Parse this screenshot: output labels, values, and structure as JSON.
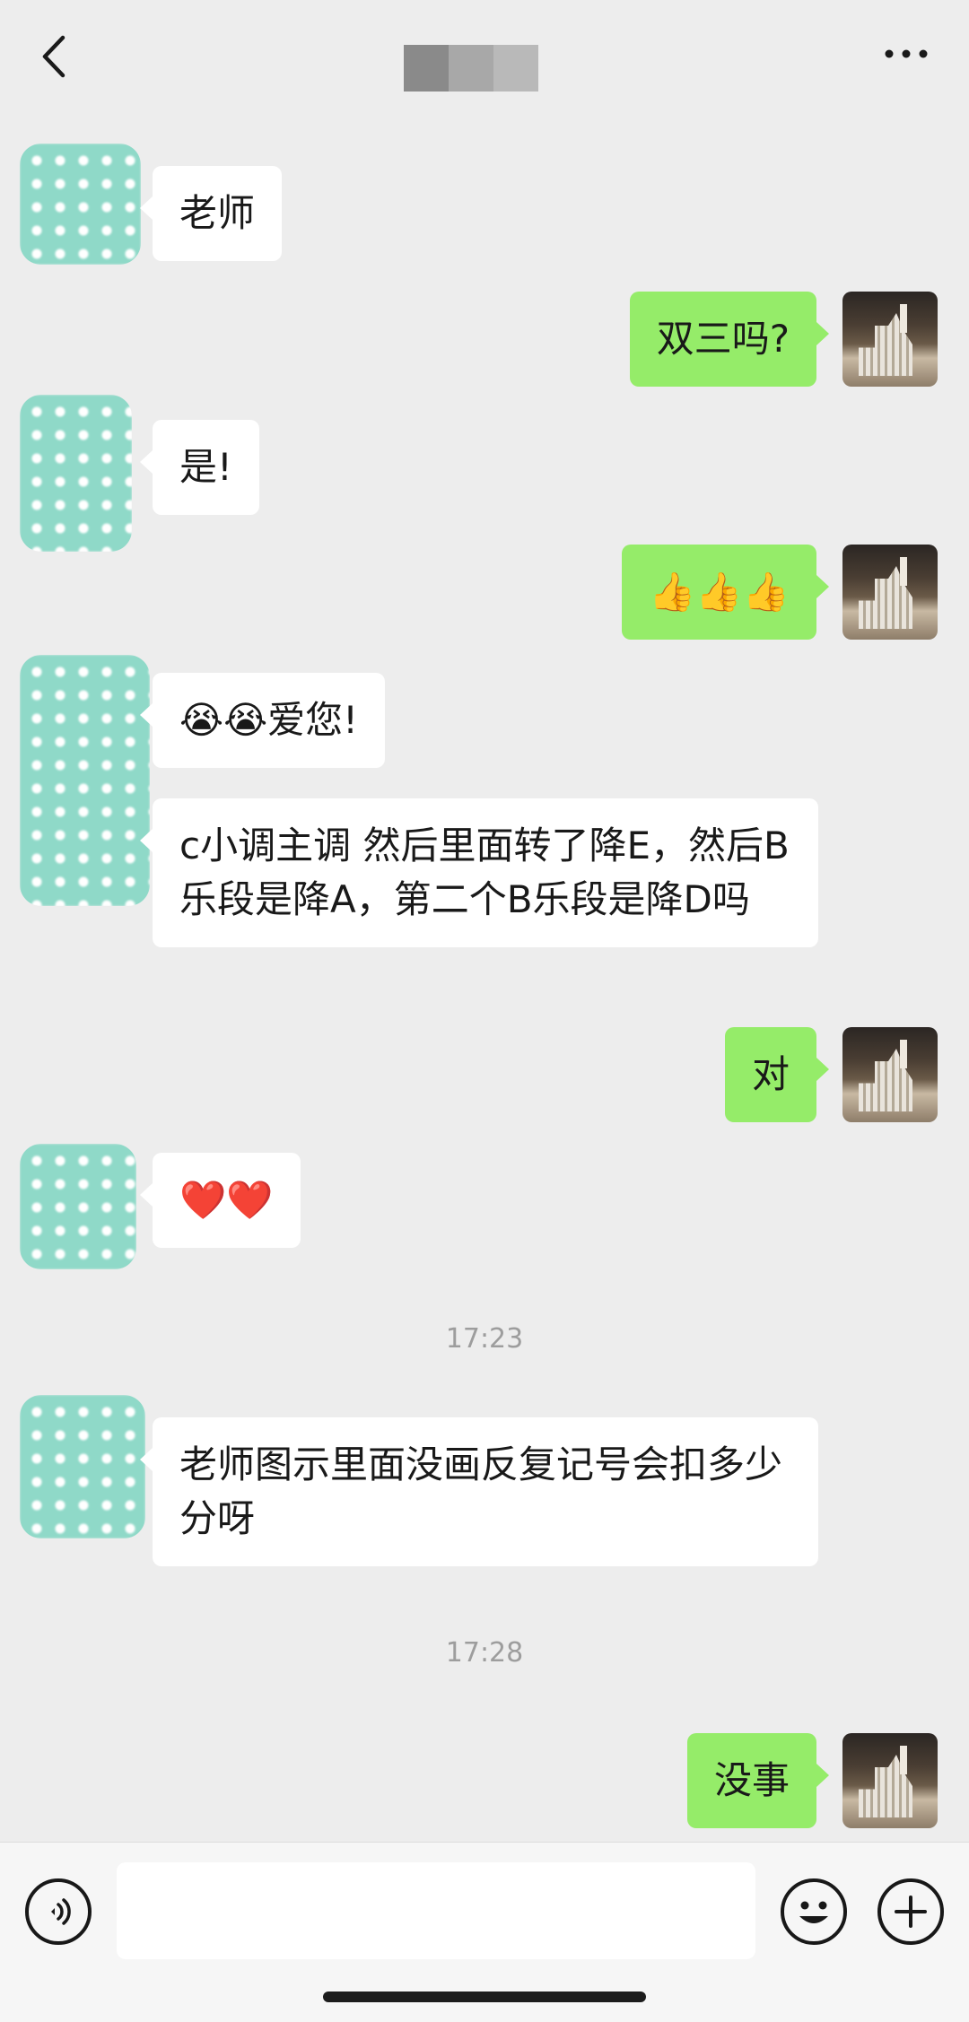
{
  "header": {
    "blurred_title_colors": [
      "#8a8a8a",
      "#a8a8a8",
      "#b9b9b9"
    ]
  },
  "messages": [
    {
      "from": "them",
      "text": "老师"
    },
    {
      "from": "me",
      "text": "双三吗?"
    },
    {
      "from": "them",
      "text": "是!"
    },
    {
      "from": "me",
      "text": "👍👍👍"
    },
    {
      "from": "them",
      "text": "😭😭爱您!"
    },
    {
      "from": "them",
      "text": "c小调主调 然后里面转了降E，然后B乐段是降A，第二个B乐段是降D吗"
    },
    {
      "from": "me",
      "text": "对"
    },
    {
      "from": "them",
      "text": "❤️❤️"
    },
    {
      "from": "them",
      "text": "老师图示里面没画反复记号会扣多少分呀"
    },
    {
      "from": "me",
      "text": "没事"
    }
  ],
  "timestamps": [
    "17:23",
    "17:28"
  ],
  "colors": {
    "background": "#ededed",
    "incoming_bubble": "#ffffff",
    "outgoing_bubble": "#95ec69",
    "avatar_teal": "#8fd9c8"
  },
  "icons": {
    "back": "chevron-left-icon",
    "more": "more-dots-icon",
    "voice": "voice-icon",
    "emoji": "emoji-icon",
    "plus": "plus-icon"
  },
  "input": {
    "value": ""
  }
}
